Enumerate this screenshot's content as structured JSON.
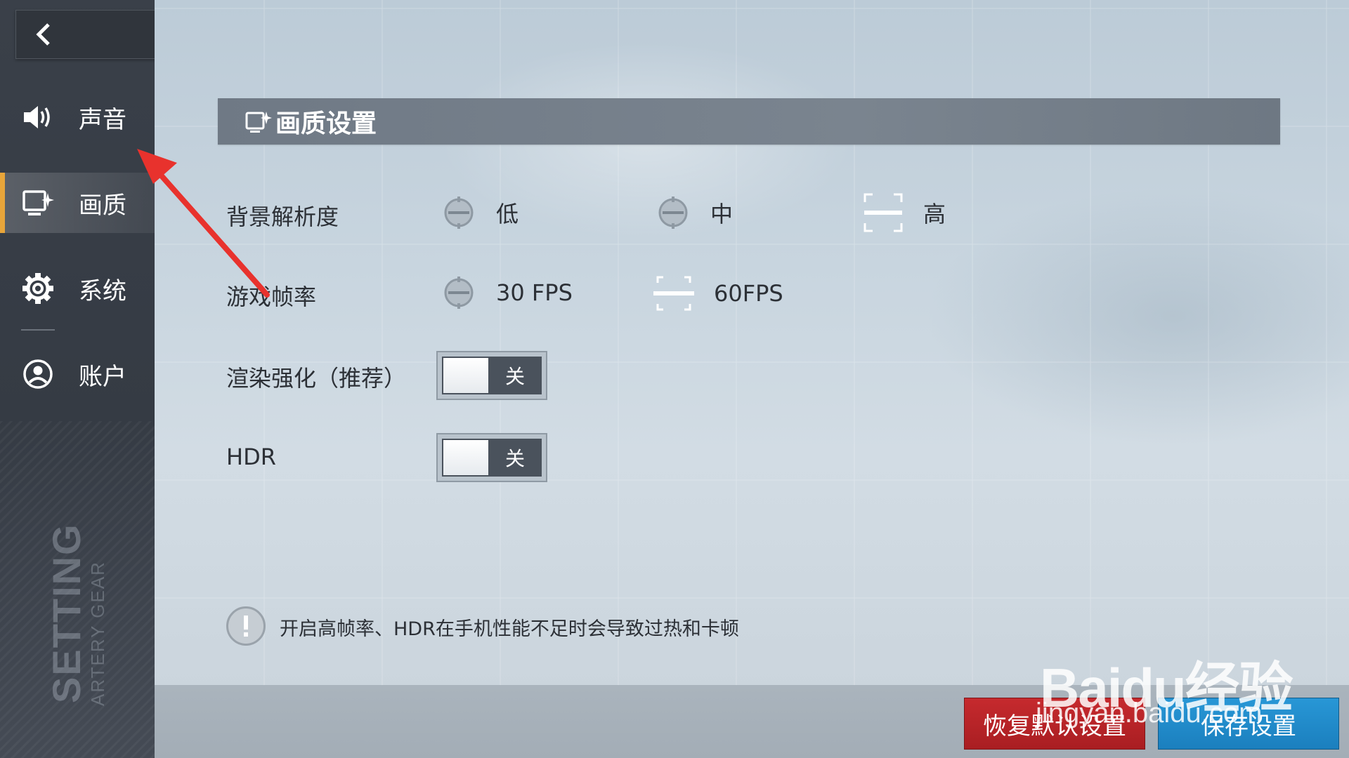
{
  "sidebar": {
    "items": [
      {
        "label": "声音",
        "icon": "speaker-icon"
      },
      {
        "label": "画质",
        "icon": "graphics-icon",
        "active": true
      },
      {
        "label": "系统",
        "icon": "gear-icon"
      },
      {
        "label": "账户",
        "icon": "user-icon"
      }
    ],
    "brand": {
      "setting": "SETTING",
      "subtitle": "ARTERY GEAR"
    }
  },
  "header": {
    "title": "画质设置"
  },
  "settings": {
    "background_resolution": {
      "label": "背景解析度",
      "options": [
        "低",
        "中",
        "高"
      ],
      "selected": "高"
    },
    "frame_rate": {
      "label": "游戏帧率",
      "options": [
        "30 FPS",
        "60FPS"
      ],
      "selected": "60FPS"
    },
    "render_enhance": {
      "label": "渲染强化（推荐）",
      "state": "关"
    },
    "hdr": {
      "label": "HDR",
      "state": "关"
    }
  },
  "warning": {
    "text": "开启高帧率、HDR在手机性能不足时会导致过热和卡顿"
  },
  "footer": {
    "reset_label": "恢复默认设置",
    "save_label": "保存设置"
  },
  "watermark": {
    "logo": "Baidu经验",
    "url": "jingyan.baidu.com"
  },
  "colors": {
    "accent_active": "#e8a53a",
    "reset_button": "#c62a2e",
    "save_button": "#2897d6",
    "annotation_arrow": "#e8322d"
  }
}
